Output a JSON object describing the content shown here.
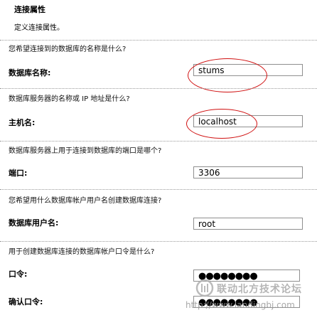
{
  "header": {
    "title": "连接属性",
    "description": "定义连接属性。"
  },
  "fields": [
    {
      "question": "您希望连接到的数据库的名称是什么?",
      "label": "数据库名称:",
      "value": "stums"
    },
    {
      "question": "数据库服务器的名称或 IP 地址是什么?",
      "label": "主机名:",
      "value": "localhost"
    },
    {
      "question": "数据库服务器上用于连接到数据库的端口是哪个?",
      "label": "端口:",
      "value": "3306"
    },
    {
      "question": "您希望用什么数据库帐户用户名创建数据库连接?",
      "label": "数据库用户名:",
      "value": "root"
    },
    {
      "question": "用于创建数据库连接的数据库帐户口令是什么?",
      "label": "口令:",
      "value": "●●●●●●●●"
    }
  ],
  "confirm": {
    "label": "确认口令:",
    "value": "●●●●●●●●"
  },
  "annotation_color": "#d01010",
  "watermark": {
    "text": "联动北方技术论坛",
    "url": "http://www.landingbj.com",
    "icon": "watermark-logo-icon"
  }
}
